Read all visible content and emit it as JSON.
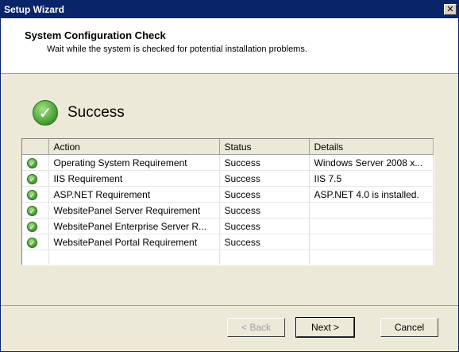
{
  "window": {
    "title": "Setup Wizard",
    "close_glyph": "✕"
  },
  "header": {
    "title": "System Configuration Check",
    "subtitle": "Wait while the system is checked for potential installation problems."
  },
  "result": {
    "label": "Success",
    "icon": "check-circle-icon"
  },
  "grid": {
    "columns": [
      "",
      "Action",
      "Status",
      "Details"
    ],
    "rows": [
      {
        "action": "Operating System Requirement",
        "status": "Success",
        "details": "Windows Server 2008 x..."
      },
      {
        "action": "IIS Requirement",
        "status": "Success",
        "details": "IIS 7.5"
      },
      {
        "action": "ASP.NET Requirement",
        "status": "Success",
        "details": "ASP.NET 4.0 is installed."
      },
      {
        "action": "WebsitePanel Server Requirement",
        "status": "Success",
        "details": ""
      },
      {
        "action": "WebsitePanel Enterprise Server R...",
        "status": "Success",
        "details": ""
      },
      {
        "action": "WebsitePanel Portal Requirement",
        "status": "Success",
        "details": ""
      }
    ]
  },
  "buttons": {
    "back": "< Back",
    "next": "Next >",
    "cancel": "Cancel"
  },
  "colors": {
    "titlebar": "#0a246a",
    "success_green": "#3f9a2a",
    "dialog_bg": "#ece9d8"
  }
}
